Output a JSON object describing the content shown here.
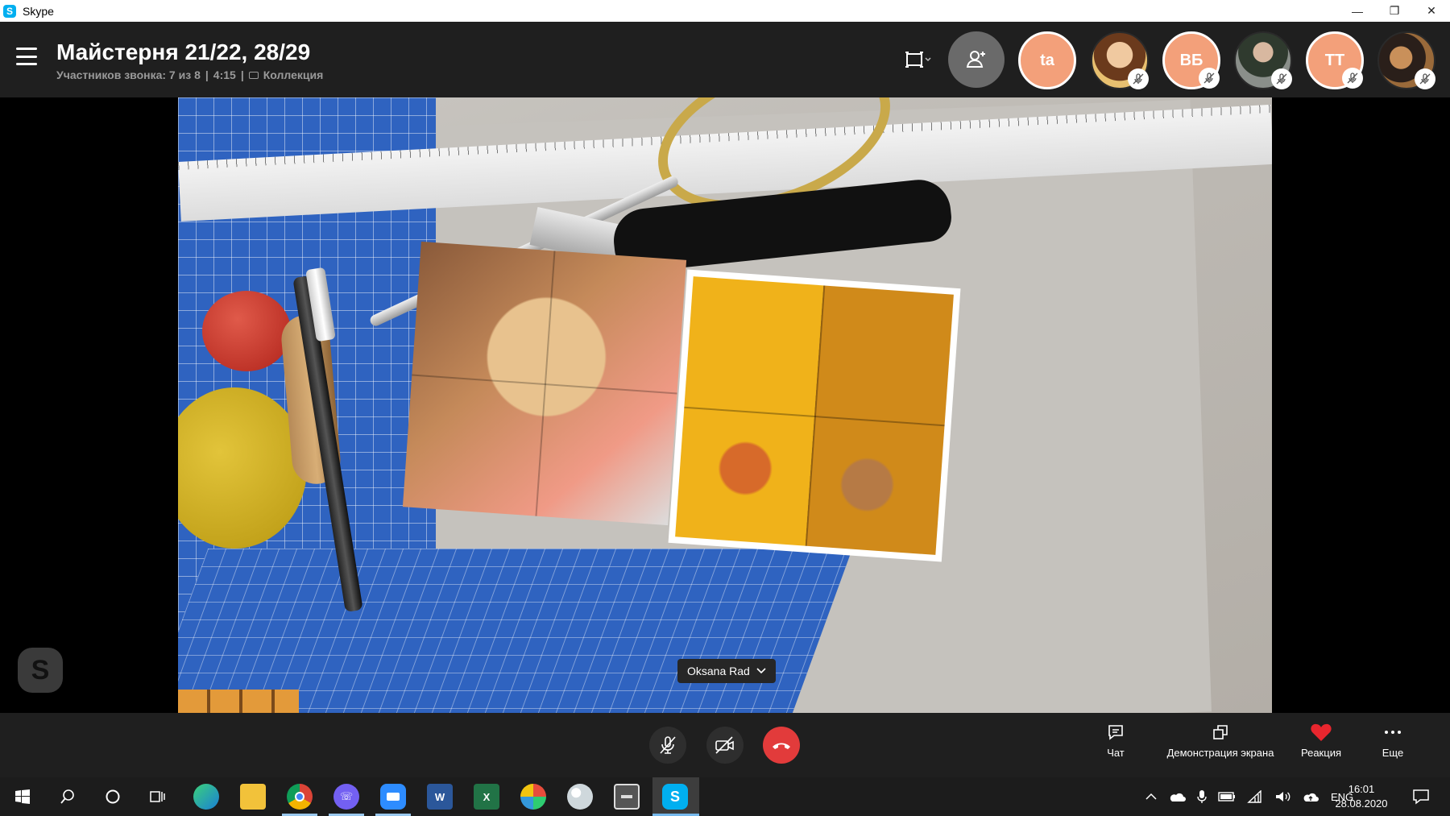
{
  "window": {
    "title": "Skype",
    "controls": {
      "minimize": "—",
      "restore": "❐",
      "close": "✕"
    }
  },
  "call": {
    "title": "Майстерня 21/22, 28/29",
    "participants_text": "Участников звонка: 7 из 8",
    "duration": "4:15",
    "separator": "|",
    "collection_label": "Коллекция"
  },
  "participants": [
    {
      "type": "initials",
      "initials": "ta",
      "muted": false
    },
    {
      "type": "photo",
      "muted": true,
      "colors": [
        "#f0c070",
        "#6b3a1c"
      ]
    },
    {
      "type": "initials",
      "initials": "ВБ",
      "muted": true
    },
    {
      "type": "photo",
      "muted": true,
      "colors": [
        "#8a8f8a",
        "#2f3a2e"
      ]
    },
    {
      "type": "initials",
      "initials": "ТТ",
      "muted": true
    },
    {
      "type": "photo",
      "muted": true,
      "colors": [
        "#9a6a3a",
        "#2a1f1a"
      ]
    }
  ],
  "video": {
    "speaker_name": "Oksana Rad"
  },
  "controls": {
    "chat_label": "Чат",
    "share_label": "Демонстрация экрана",
    "reaction_label": "Реакция",
    "more_label": "Еще",
    "accent_end": "#e23b3b",
    "reaction_color": "#e8262e"
  },
  "taskbar": {
    "language": "ENG",
    "time": "16:01",
    "date": "28.08.2020",
    "apps": [
      "start",
      "search",
      "cortana",
      "task-view",
      "edge",
      "file-explorer",
      "chrome",
      "viber",
      "zoom",
      "word",
      "excel",
      "paint3d",
      "palette",
      "calculator",
      "skype"
    ]
  }
}
